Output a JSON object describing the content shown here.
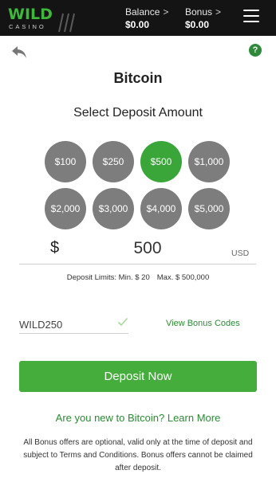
{
  "header": {
    "logo_main": "WILD",
    "logo_sub": "CASINO",
    "balance_label": "Balance",
    "balance_value": "$0.00",
    "bonus_label": "Bonus",
    "bonus_value": "$0.00",
    "chevron": ">"
  },
  "help_icon_text": "?",
  "page_title": "Bitcoin",
  "deposit_heading": "Select Deposit Amount",
  "amount_options": [
    "$100",
    "$250",
    "$500",
    "$1,000",
    "$2,000",
    "$3,000",
    "$4,000",
    "$5,000"
  ],
  "selected_amount": "$500",
  "amount_field": {
    "currency_symbol": "$",
    "value": "500",
    "currency_code": "USD"
  },
  "limits": {
    "min": "Deposit Limits: Min. $ 20",
    "max": "Max. $ 500,000"
  },
  "bonus_code": {
    "value": "WILD250",
    "view_codes_label": "View Bonus Codes"
  },
  "deposit_button_label": "Deposit Now",
  "learn_more_label": "Are you new to Bitcoin? Learn More",
  "disclaimer": "All Bonus offers are optional, valid only at the time of deposit and subject to Terms and Conditions. Bonus offers cannot be claimed after deposit.",
  "colors": {
    "header_bg": "#141414",
    "brand_green": "#3db83b",
    "selected_amount": "#3aa63a",
    "unselected_amount": "#7d7d7d",
    "button": "#45ad3b",
    "link": "#2d8a36"
  },
  "icons": {
    "back": "undo-arrow-icon",
    "help": "question-circle-icon",
    "menu": "hamburger-menu-icon",
    "check": "checkmark-icon"
  }
}
